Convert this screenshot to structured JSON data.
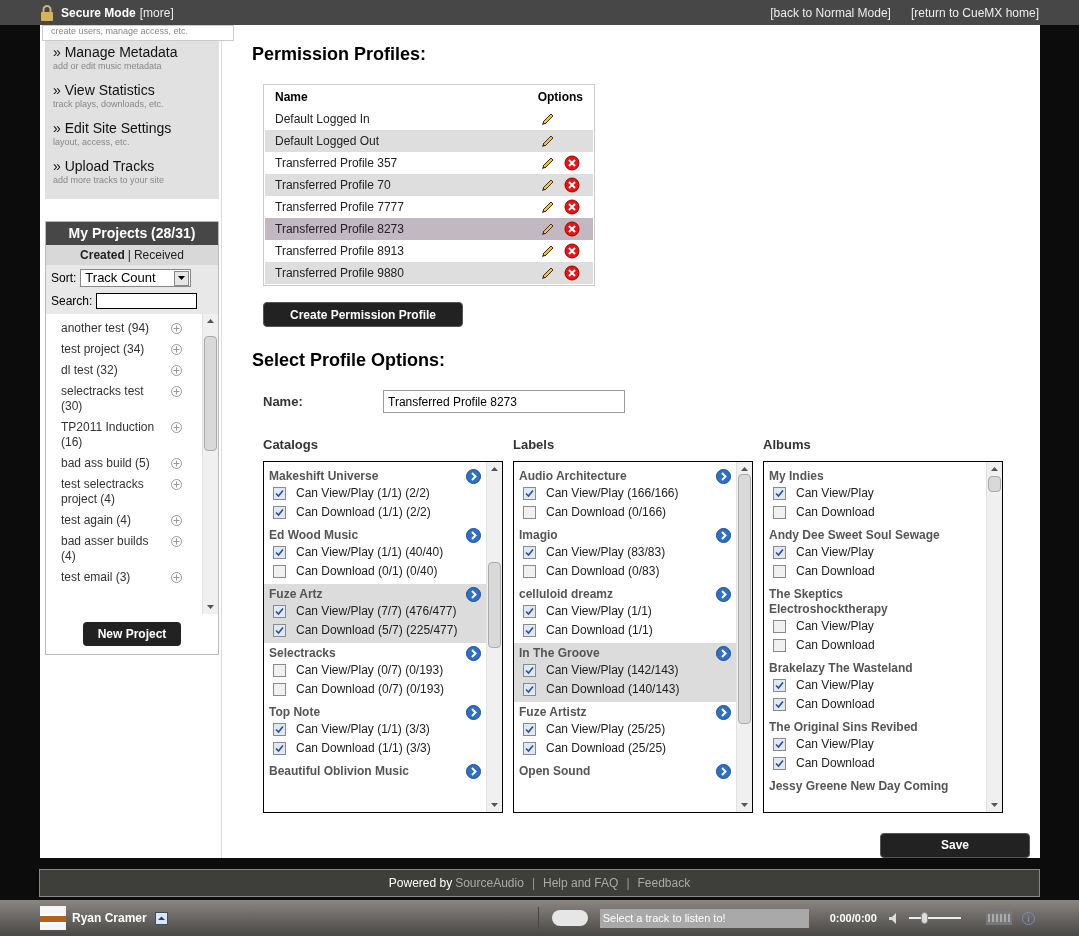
{
  "top_bar": {
    "title": "Secure Mode",
    "more_link": "[more]",
    "links": [
      "[back to Normal Mode]",
      "[return to CueMX home]"
    ]
  },
  "sidebar": {
    "menu": [
      {
        "subtitle": "create users, manage access, etc.",
        "selected": true
      },
      {
        "title": "» Manage Metadata",
        "subtitle": "add or edit music metadata",
        "selected": false
      },
      {
        "title": "» View Statistics",
        "subtitle": "track plays, downloads, etc.",
        "selected": false
      },
      {
        "title": "» Edit Site Settings",
        "subtitle": "layout, access, etc.",
        "selected": false
      },
      {
        "title": "» Upload Tracks",
        "subtitle": "add more tracks to your site",
        "selected": false
      }
    ],
    "projects": {
      "title": "My Projects (28/31)",
      "tabs": [
        {
          "label": "Created",
          "selected": true
        },
        {
          "label": "Received",
          "selected": false
        }
      ],
      "tab_separator": "|",
      "sort_label": "Sort:",
      "sort_value": "Track Count",
      "search_label": "Search:",
      "items": [
        "another test (94)",
        "test project (34)",
        "dl test (32)",
        "selectracks test (30)",
        "TP2011 Induction (16)",
        "bad ass build (5)",
        "test selectracks project (4)",
        "test again (4)",
        "bad asser builds (4)",
        "test email (3)"
      ],
      "new_button": "New Project"
    }
  },
  "profiles": {
    "heading": "Permission Profiles:",
    "columns": [
      "Name",
      "Options"
    ],
    "rows": [
      {
        "name": "Default Logged In",
        "selected": false,
        "deletable": false
      },
      {
        "name": "Default Logged Out",
        "selected": false,
        "deletable": false
      },
      {
        "name": "Transferred Profile 357",
        "selected": false,
        "deletable": true
      },
      {
        "name": "Transferred Profile 70",
        "selected": false,
        "deletable": true
      },
      {
        "name": "Transferred Profile 7777",
        "selected": false,
        "deletable": true
      },
      {
        "name": "Transferred Profile 8273",
        "selected": true,
        "deletable": true
      },
      {
        "name": "Transferred Profile 8913",
        "selected": false,
        "deletable": true
      },
      {
        "name": "Transferred Profile 9880",
        "selected": false,
        "deletable": true
      }
    ],
    "create_button": "Create Permission Profile"
  },
  "options": {
    "heading": "Select Profile Options:",
    "name_label": "Name:",
    "name_value": "Transferred Profile 8273",
    "lists": [
      {
        "title": "Catalogs",
        "arrows": true,
        "groups": [
          {
            "name": "Makeshift Universe",
            "selected": false,
            "permissions": [
              {
                "label": "Can View/Play (1/1) (2/2)",
                "checked": true
              },
              {
                "label": "Can Download (1/1) (2/2)",
                "checked": true
              }
            ]
          },
          {
            "name": "Ed Wood Music",
            "selected": false,
            "permissions": [
              {
                "label": "Can View/Play (1/1) (40/40)",
                "checked": true
              },
              {
                "label": "Can Download (0/1) (0/40)",
                "checked": false
              }
            ]
          },
          {
            "name": "Fuze Artz",
            "selected": true,
            "permissions": [
              {
                "label": "Can View/Play (7/7) (476/477)",
                "checked": true
              },
              {
                "label": "Can Download (5/7) (225/477)",
                "checked": true
              }
            ]
          },
          {
            "name": "Selectracks",
            "selected": false,
            "permissions": [
              {
                "label": "Can View/Play (0/7) (0/193)",
                "checked": false
              },
              {
                "label": "Can Download (0/7) (0/193)",
                "checked": false
              }
            ]
          },
          {
            "name": "Top Note",
            "selected": false,
            "permissions": [
              {
                "label": "Can View/Play (1/1) (3/3)",
                "checked": true
              },
              {
                "label": "Can Download (1/1) (3/3)",
                "checked": true
              }
            ]
          },
          {
            "name": "Beautiful Oblivion Music",
            "selected": false
          }
        ]
      },
      {
        "title": "Labels",
        "arrows": true,
        "groups": [
          {
            "name": "Audio Architecture",
            "selected": false,
            "permissions": [
              {
                "label": "Can View/Play (166/166)",
                "checked": true
              },
              {
                "label": "Can Download (0/166)",
                "checked": false
              }
            ]
          },
          {
            "name": "Imagio",
            "selected": false,
            "permissions": [
              {
                "label": "Can View/Play (83/83)",
                "checked": true
              },
              {
                "label": "Can Download (0/83)",
                "checked": false
              }
            ]
          },
          {
            "name": "celluloid dreamz",
            "selected": false,
            "permissions": [
              {
                "label": "Can View/Play (1/1)",
                "checked": true
              },
              {
                "label": "Can Download (1/1)",
                "checked": true
              }
            ]
          },
          {
            "name": "In The Groove",
            "selected": true,
            "permissions": [
              {
                "label": "Can View/Play (142/143)",
                "checked": true
              },
              {
                "label": "Can Download (140/143)",
                "checked": true
              }
            ]
          },
          {
            "name": "Fuze Artistz",
            "selected": false,
            "permissions": [
              {
                "label": "Can View/Play (25/25)",
                "checked": true
              },
              {
                "label": "Can Download (25/25)",
                "checked": true
              }
            ]
          },
          {
            "name": "Open Sound",
            "selected": false
          }
        ]
      },
      {
        "title": "Albums",
        "arrows": false,
        "groups": [
          {
            "name": "My Indies",
            "selected": false,
            "permissions": [
              {
                "label": "Can View/Play",
                "checked": true
              },
              {
                "label": "Can Download",
                "checked": false
              }
            ]
          },
          {
            "name": "Andy Dee Sweet Soul Sewage",
            "selected": false,
            "permissions": [
              {
                "label": "Can View/Play",
                "checked": true
              },
              {
                "label": "Can Download",
                "checked": false
              }
            ]
          },
          {
            "name": "The Skeptics Electroshocktherapy",
            "selected": false,
            "permissions": [
              {
                "label": "Can View/Play",
                "checked": false
              },
              {
                "label": "Can Download",
                "checked": false
              }
            ]
          },
          {
            "name": "Brakelazy The Wasteland",
            "selected": false,
            "permissions": [
              {
                "label": "Can View/Play",
                "checked": true
              },
              {
                "label": "Can Download",
                "checked": true
              }
            ]
          },
          {
            "name": "The Original Sins Revibed",
            "selected": false,
            "permissions": [
              {
                "label": "Can View/Play",
                "checked": true
              },
              {
                "label": "Can Download",
                "checked": true
              }
            ]
          },
          {
            "name": "Jessy Greene New Day Coming",
            "selected": false
          }
        ]
      }
    ],
    "save_button": "Save"
  },
  "footer": {
    "prefix": "Powered by",
    "links": [
      "SourceAudio",
      "Help and FAQ",
      "Feedback"
    ],
    "separator": "|"
  },
  "player": {
    "user": "Ryan Cramer",
    "track_placeholder": "Select a track to listen to!",
    "time": "0:00/0:00",
    "volume": {
      "level": 0.3
    }
  }
}
